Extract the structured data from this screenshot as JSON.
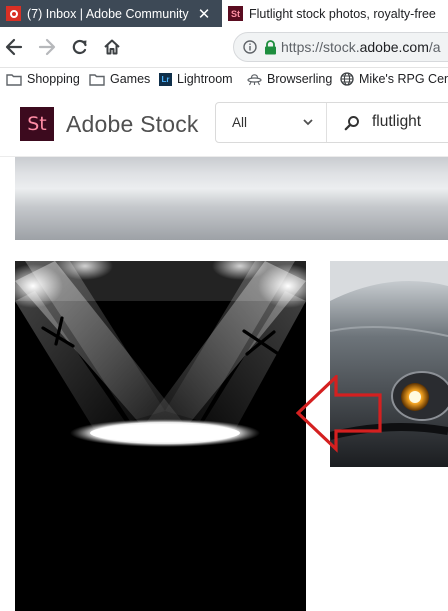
{
  "browser": {
    "tabs": [
      {
        "title": "(7) Inbox | Adobe Community",
        "active": false
      },
      {
        "title": "Flutlight stock photos, royalty-free",
        "active": true
      }
    ],
    "url": {
      "scheme": "https://",
      "host_plain": "stock.",
      "host_bold": "adobe.com",
      "path": "/a"
    },
    "bookmarks": [
      {
        "label": "Shopping",
        "icon": "folder-icon"
      },
      {
        "label": "Games",
        "icon": "folder-icon"
      },
      {
        "label": "Lightroom",
        "icon": "lightroom-icon"
      },
      {
        "label": "Browserling",
        "icon": "ufo-icon"
      },
      {
        "label": "Mike's RPG Cent",
        "icon": "globe-icon"
      }
    ]
  },
  "stock": {
    "logo_text": "St",
    "brand": "Adobe Stock",
    "scope": "All",
    "query": "flutlight"
  },
  "colors": {
    "active_tab": "#3d4956",
    "logo_bg": "#3c0a1e",
    "logo_fg": "#ff8ca5",
    "secure_lock": "#1e8e3e",
    "annotation_arrow": "#d42020"
  }
}
